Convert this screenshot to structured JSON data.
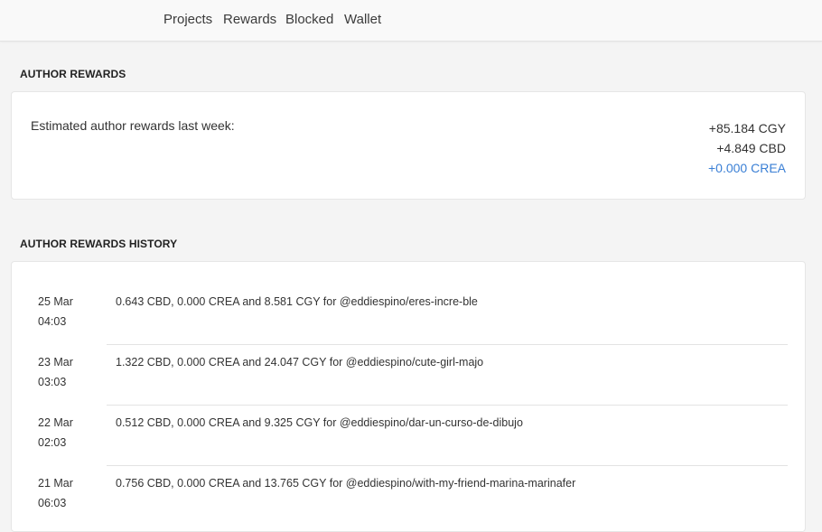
{
  "nav": {
    "items": [
      "Projects",
      "Rewards",
      "Blocked",
      "Wallet"
    ]
  },
  "author_rewards": {
    "title": "AUTHOR REWARDS",
    "estimated_label": "Estimated author rewards last week:",
    "amounts": {
      "cgy": "+85.184 CGY",
      "cbd": "+4.849 CBD",
      "crea": "+0.000 CREA"
    }
  },
  "history": {
    "title": "AUTHOR REWARDS HISTORY",
    "rows": [
      {
        "date": "25 Mar",
        "time": "04:03",
        "detail": "0.643 CBD, 0.000 CREA and 8.581 CGY for @eddiespino/eres-incre-ble"
      },
      {
        "date": "23 Mar",
        "time": "03:03",
        "detail": "1.322 CBD, 0.000 CREA and 24.047 CGY for @eddiespino/cute-girl-majo"
      },
      {
        "date": "22 Mar",
        "time": "02:03",
        "detail": "0.512 CBD, 0.000 CREA and 9.325 CGY for @eddiespino/dar-un-curso-de-dibujo"
      },
      {
        "date": "21 Mar",
        "time": "06:03",
        "detail": "0.756 CBD, 0.000 CREA and 13.765 CGY for @eddiespino/with-my-friend-marina-marinafer"
      }
    ]
  },
  "colors": {
    "crea_accent": "#3a7fd5",
    "page_bg": "#f4f4f4",
    "card_bg": "#ffffff"
  }
}
